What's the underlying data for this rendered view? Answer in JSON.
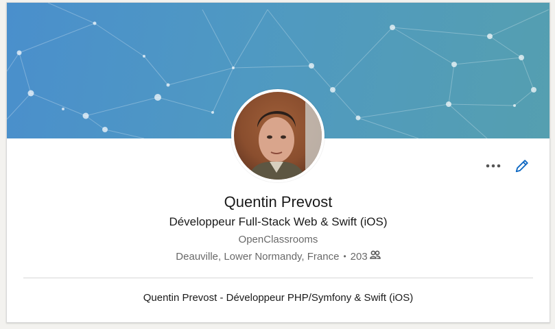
{
  "profile": {
    "name": "Quentin Prevost",
    "headline": "Développeur Full-Stack Web & Swift (iOS)",
    "company": "OpenClassrooms",
    "location": "Deauville, Lower Normandy, France",
    "separator": "•",
    "connections_count": "203",
    "summary": "Quentin Prevost - Développeur PHP/Symfony & Swift (iOS)"
  },
  "icons": {
    "more": "more-horizontal-icon",
    "edit": "pencil-icon",
    "connections": "people-icon"
  },
  "colors": {
    "banner_start": "#4a8fcc",
    "banner_end": "#559fb0",
    "accent": "#0a66c2"
  }
}
